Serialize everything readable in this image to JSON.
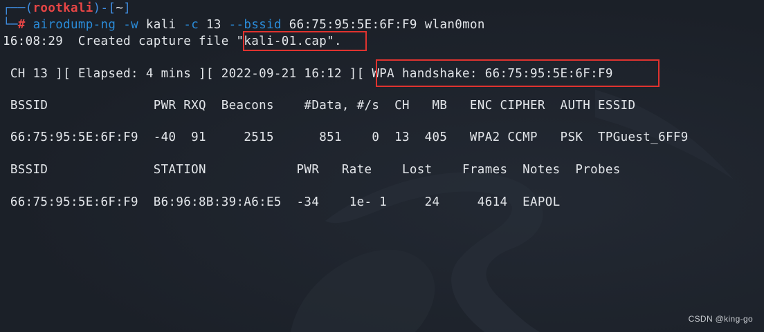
{
  "prompt": {
    "corner_top": "┌──(",
    "user": "rootkali",
    "mid": ")-[",
    "path": "~",
    "end": "]",
    "corner_bottom": "└─",
    "symbol": "#"
  },
  "command": {
    "program": "airodump-ng",
    "flag_w": "-w",
    "arg_w": "kali",
    "flag_c": "-c",
    "arg_c": "13",
    "flag_bssid": "--bssid",
    "arg_bssid": "66:75:95:5E:6F:F9",
    "interface": "wlan0mon"
  },
  "output": {
    "created_prefix": "16:08:29  Created capture file ",
    "created_file": "\"kali-01.cap\".",
    "status_left": " CH 13 ][ Elapsed: 4 mins ][ 2022-09-21 16:12 ]",
    "status_right": "[ WPA handshake: 66:75:95:5E:6F:F9",
    "ap_header": " BSSID              PWR RXQ  Beacons    #Data, #/s  CH   MB   ENC CIPHER  AUTH ESSID",
    "ap_row": " 66:75:95:5E:6F:F9  -40  91     2515      851    0  13  405   WPA2 CCMP   PSK  TPGuest_6FF9",
    "sta_header": " BSSID              STATION            PWR   Rate    Lost    Frames  Notes  Probes",
    "sta_row": " 66:75:95:5E:6F:F9  B6:96:8B:39:A6:E5  -34    1e- 1     24     4614  EAPOL"
  },
  "watermark": "CSDN @king-go",
  "colors": {
    "background": "#1d222a",
    "prompt_blue": "#3f8de0",
    "user_red": "#e64545",
    "highlight_box": "#e0332f"
  }
}
